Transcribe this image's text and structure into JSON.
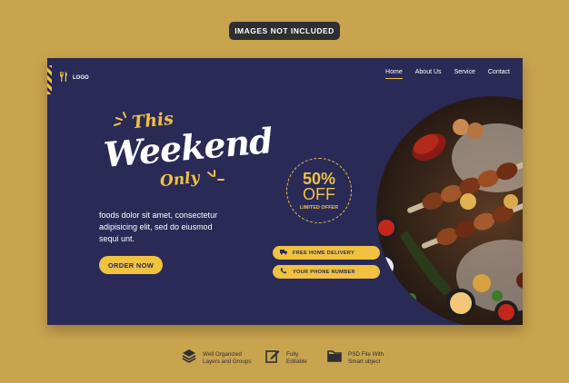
{
  "badge": "IMAGES NOT INCLUDED",
  "logo": {
    "text": "LOGO",
    "icon": "fork-knife-icon"
  },
  "nav": [
    "Home",
    "About Us",
    "Service",
    "Contact"
  ],
  "hero": {
    "this": "This",
    "weekend": "Weekend",
    "only": "Only",
    "desc1": "foods dolor sit amet, consectetur",
    "desc2": "adipisicing elit, sed do eiusmod",
    "desc3": "sequi unt.",
    "cta": "ORDER NOW"
  },
  "offer": {
    "percent": "50%",
    "off": "OFF",
    "label": "LIMITED OFFER"
  },
  "pills": [
    {
      "icon": "truck-icon",
      "text": "FREE HOME DELIVERY"
    },
    {
      "icon": "phone-icon",
      "text": "YOUR PHONE NUMBER"
    }
  ],
  "features": [
    {
      "icon": "layers-icon",
      "line1": "Well Organized",
      "line2": "Layers and Groups"
    },
    {
      "icon": "edit-icon",
      "line1": "Fully",
      "line2": "Editable"
    },
    {
      "icon": "folder-icon",
      "line1": "PSD File With",
      "line2": "Smart object"
    }
  ],
  "colors": {
    "accent": "#f0c240",
    "panel": "#2a2a57",
    "background": "#c9a44f"
  }
}
